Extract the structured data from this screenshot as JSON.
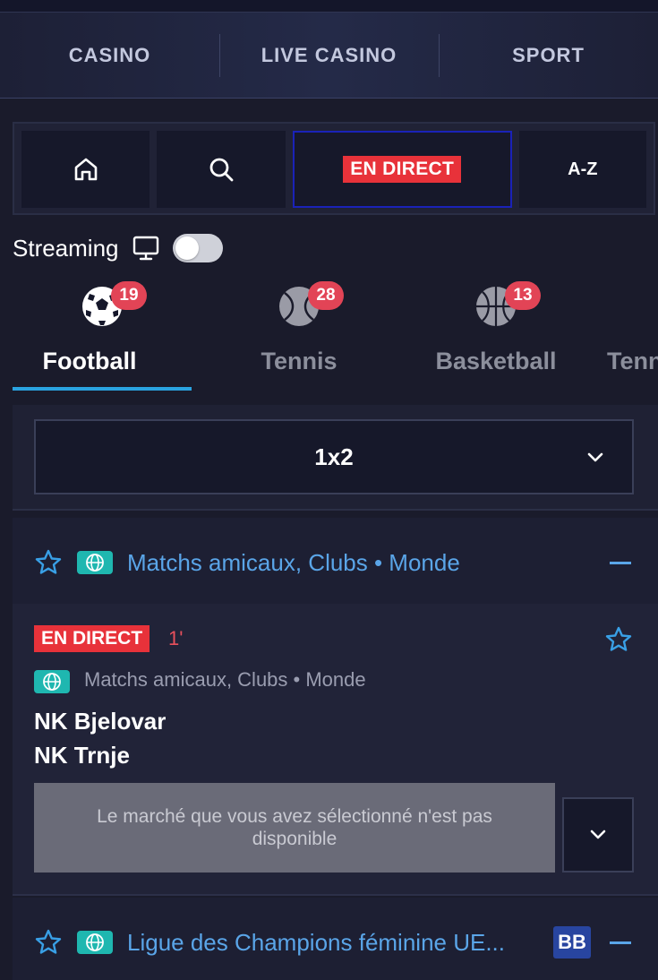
{
  "top_nav": [
    "CASINO",
    "LIVE CASINO",
    "SPORT"
  ],
  "quick_bar": {
    "home_icon": "home-icon",
    "search_icon": "search-icon",
    "live_label": "EN DIRECT",
    "az_label": "A-Z"
  },
  "streaming": {
    "label": "Streaming",
    "icon": "monitor-icon",
    "enabled": false
  },
  "sports": [
    {
      "name": "Football",
      "count": "19",
      "icon": "football-icon",
      "active": true
    },
    {
      "name": "Tennis",
      "count": "28",
      "icon": "tennis-ball-icon",
      "active": false
    },
    {
      "name": "Basketball",
      "count": "13",
      "icon": "basketball-icon",
      "active": false
    },
    {
      "name": "Tenn",
      "count": "",
      "icon": "",
      "active": false
    }
  ],
  "market": {
    "selected": "1x2"
  },
  "leagues": [
    {
      "name": "Matchs amicaux, Clubs • Monde",
      "badge": ""
    },
    {
      "name": "Ligue des Champions féminine UE...",
      "badge": "BB"
    }
  ],
  "match": {
    "status": "EN DIRECT",
    "minute": "1'",
    "competition": "Matchs amicaux, Clubs • Monde",
    "home_team": "NK Bjelovar",
    "away_team": "NK Trnje",
    "unavailable_message": "Le marché que vous avez sélectionné n'est pas disponible"
  },
  "colors": {
    "live_red": "#e8323a",
    "accent_blue": "#5aa5e8",
    "tab_underline": "#2aa3e0",
    "globe_teal": "#1fb7b0"
  }
}
